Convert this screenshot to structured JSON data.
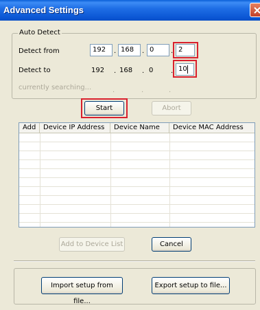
{
  "window": {
    "title": "Advanced Settings"
  },
  "auto_detect": {
    "group_label": "Auto Detect",
    "from_label": "Detect from",
    "to_label": "Detect to",
    "from_ip": [
      "192",
      "168",
      "0",
      "2"
    ],
    "to_ip": [
      "192",
      "168",
      "0",
      "10"
    ],
    "status": "currently searching..."
  },
  "buttons": {
    "start": "Start",
    "abort": "Abort",
    "add_to_list": "Add to Device List",
    "cancel": "Cancel",
    "import": "Import setup from file...",
    "export": "Export setup to file..."
  },
  "table": {
    "columns": [
      "Add",
      "Device IP Address",
      "Device Name",
      "Device MAC Address"
    ]
  },
  "colors": {
    "highlight": "#d9202d",
    "title_bar": "#0b56d4"
  },
  "icons": {
    "close": "close-icon"
  }
}
